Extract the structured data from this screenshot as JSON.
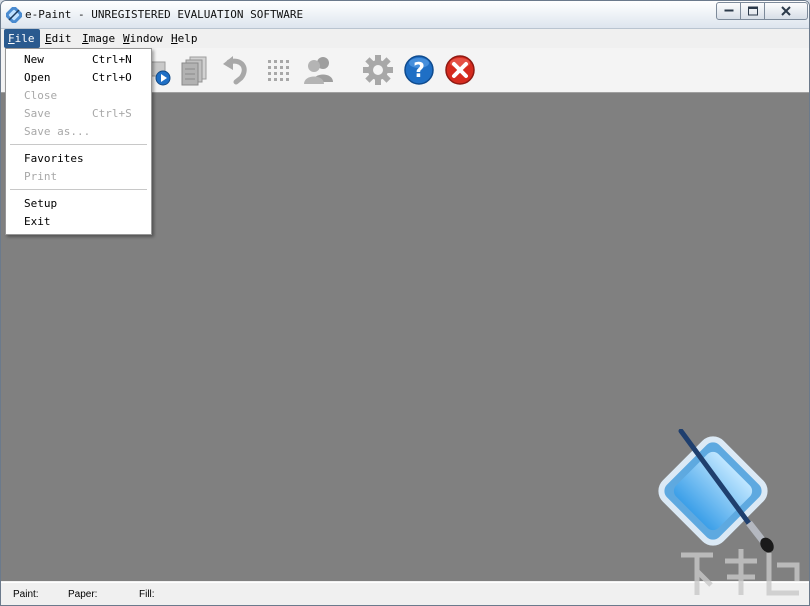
{
  "window": {
    "title": "e-Paint - UNREGISTERED EVALUATION SOFTWARE",
    "buttons": [
      "minimize",
      "maximize",
      "close"
    ]
  },
  "menubar": {
    "items": [
      {
        "label": "File",
        "underline": "F",
        "rest": "ile",
        "active": true
      },
      {
        "label": "Edit",
        "underline": "E",
        "rest": "dit",
        "active": false
      },
      {
        "label": "Image",
        "underline": "I",
        "rest": "mage",
        "active": false
      },
      {
        "label": "Window",
        "underline": "W",
        "rest": "indow",
        "active": false
      },
      {
        "label": "Help",
        "underline": "H",
        "rest": "elp",
        "active": false
      }
    ]
  },
  "file_menu": {
    "items": [
      {
        "label": "New",
        "shortcut": "Ctrl+N",
        "enabled": true
      },
      {
        "label": "Open",
        "shortcut": "Ctrl+O",
        "enabled": true
      },
      {
        "label": "Close",
        "shortcut": "",
        "enabled": false
      },
      {
        "label": "Save",
        "shortcut": "Ctrl+S",
        "enabled": false
      },
      {
        "label": "Save as...",
        "shortcut": "",
        "enabled": false
      },
      {
        "label": "Favorites",
        "shortcut": "",
        "enabled": true
      },
      {
        "label": "Print",
        "shortcut": "",
        "enabled": false
      },
      {
        "label": "Setup",
        "shortcut": "",
        "enabled": true
      },
      {
        "label": "Exit",
        "shortcut": "",
        "enabled": true
      }
    ]
  },
  "toolbar": {
    "icons": [
      "slideshow-icon",
      "pages-icon",
      "undo-icon",
      "grid-icon",
      "users-icon",
      "settings-gear-icon",
      "help-icon",
      "exit-icon"
    ]
  },
  "statusbar": {
    "paint_label": "Paint:",
    "paper_label": "Paper:",
    "fill_label": "Fill:"
  },
  "colors": {
    "workspace": "#808080",
    "menu_highlight": "#2a5a8f",
    "help_blue": "#1f6fc5",
    "exit_red": "#d52b1e"
  }
}
